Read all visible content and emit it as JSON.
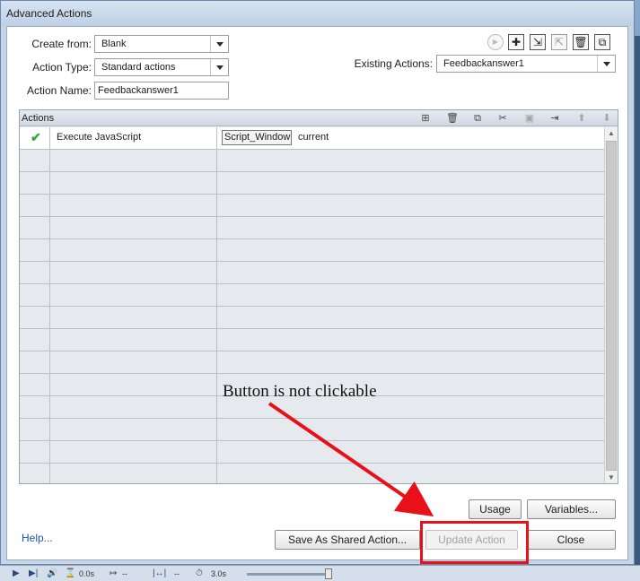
{
  "dialog": {
    "title": "Advanced Actions"
  },
  "form": {
    "create_from_label": "Create from:",
    "create_from_value": "Blank",
    "action_type_label": "Action Type:",
    "action_type_value": "Standard actions",
    "action_name_label": "Action Name:",
    "action_name_value": "Feedbackanswer1",
    "existing_actions_label": "Existing Actions:",
    "existing_actions_value": "Feedbackanswer1"
  },
  "toolbar": {
    "icons": [
      "preview-icon",
      "add-icon",
      "import-icon",
      "export-icon",
      "delete-icon",
      "duplicate-icon"
    ]
  },
  "grid": {
    "header": "Actions",
    "header_icons": [
      "insert-row-icon",
      "delete-row-icon",
      "copy-icon",
      "cut-icon",
      "paste-icon",
      "indent-icon",
      "move-up-icon",
      "move-down-icon"
    ],
    "rows": [
      {
        "action": "Execute JavaScript",
        "object": "Script_Window",
        "target": "current",
        "status": "valid"
      }
    ]
  },
  "buttons": {
    "usage": "Usage",
    "variables": "Variables...",
    "save_shared": "Save As Shared Action...",
    "update": "Update Action",
    "close": "Close",
    "help": "Help..."
  },
  "annotation": {
    "text": "Button is not clickable",
    "color": "#e8111a"
  },
  "timeline": {
    "time1": "0.0s",
    "time2": "--",
    "time3": "--",
    "time4": "3.0s"
  }
}
